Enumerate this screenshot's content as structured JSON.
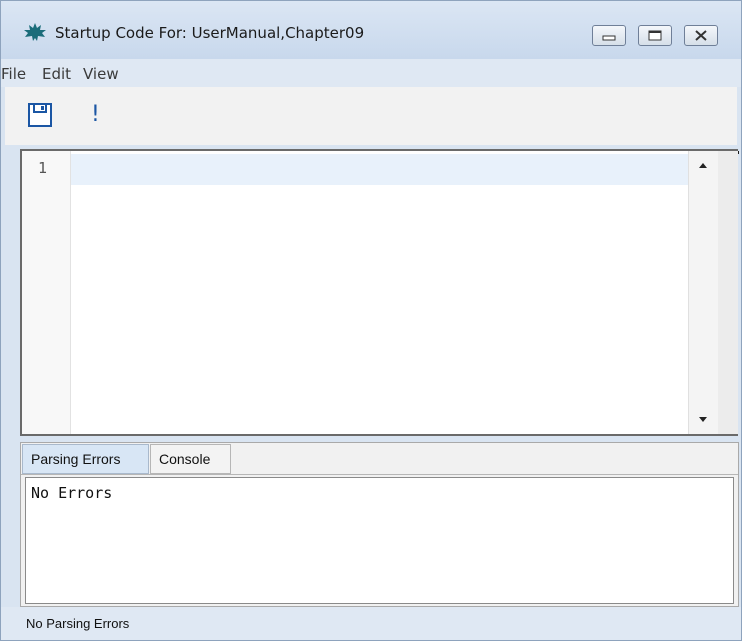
{
  "window": {
    "title": "Startup Code For: UserManual,Chapter09"
  },
  "icons": {
    "app": "maple-leaf-icon",
    "minimize": "minimize-icon",
    "maximize": "maximize-icon",
    "close": "close-icon",
    "save": "save-icon",
    "run": "exclamation-icon"
  },
  "menubar": {
    "items": [
      "File",
      "Edit",
      "View"
    ]
  },
  "toolbar": {
    "run_label": "!"
  },
  "editor": {
    "line_numbers": [
      "1"
    ],
    "content": ""
  },
  "bottom_panel": {
    "tabs": [
      {
        "label": "Parsing Errors",
        "selected": true
      },
      {
        "label": "Console",
        "selected": false
      }
    ],
    "output": "No Errors"
  },
  "statusbar": {
    "text": "No Parsing Errors"
  },
  "colors": {
    "title_bg": "#d6e2f1",
    "current_line": "#e8f1fb",
    "selected_tab": "#d8e6f5",
    "run_icon": "#1b56a4"
  }
}
